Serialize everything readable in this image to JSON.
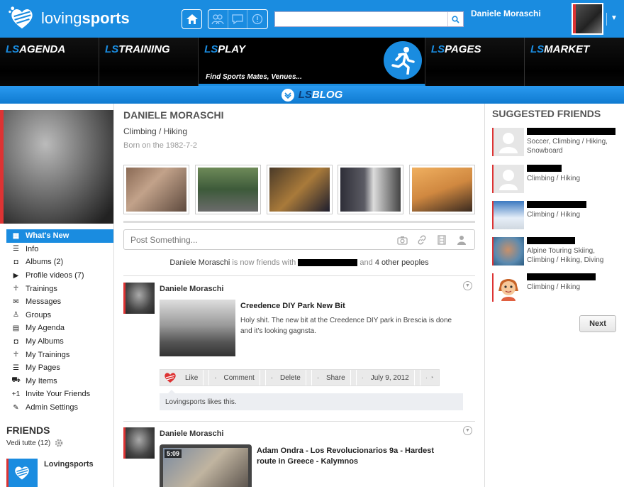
{
  "brand": {
    "name_light": "loving",
    "name_bold": "sports",
    "accent": "#1a8ce0",
    "alert": "#d33333"
  },
  "header": {
    "search_placeholder": "",
    "user_name": "Daniele Moraschi",
    "icons": [
      "home-icon",
      "friends-icon",
      "messages-icon",
      "notifications-icon",
      "search-icon",
      "chevron-down-icon"
    ]
  },
  "nav": {
    "items": [
      {
        "prefix": "LS",
        "label": "AGENDA"
      },
      {
        "prefix": "LS",
        "label": "TRAINING"
      },
      {
        "prefix": "LS",
        "label": "PLAY",
        "sub": "Find Sports Mates, Venues..."
      },
      {
        "prefix": "LS",
        "label": "PAGES"
      },
      {
        "prefix": "LS",
        "label": "MARKET"
      }
    ],
    "blog": {
      "prefix": "LS",
      "label": "BLOG"
    }
  },
  "sidebar": {
    "menu": [
      {
        "label": "What's New",
        "icon": "grid-icon"
      },
      {
        "label": "Info",
        "icon": "list-icon"
      },
      {
        "label": "Albums (2)",
        "icon": "camera-icon"
      },
      {
        "label": "Profile videos (7)",
        "icon": "play-icon"
      },
      {
        "label": "Trainings",
        "icon": "runner-icon"
      },
      {
        "label": "Messages",
        "icon": "chat-icon"
      },
      {
        "label": "Groups",
        "icon": "group-icon"
      },
      {
        "label": "My Agenda",
        "icon": "calendar-icon"
      },
      {
        "label": "My Albums",
        "icon": "camera-icon"
      },
      {
        "label": "My Trainings",
        "icon": "runner-icon"
      },
      {
        "label": "My Pages",
        "icon": "list-icon"
      },
      {
        "label": "My Items",
        "icon": "cart-icon"
      },
      {
        "label": "Invite Your Friends",
        "icon": "plus-one-icon"
      },
      {
        "label": "Admin Settings",
        "icon": "pencil-icon"
      }
    ],
    "friends_title": "FRIENDS",
    "friends_link": "Vedi tutte (12)",
    "friend_name": "Lovingsports"
  },
  "profile": {
    "name": "DANIELE MORASCHI",
    "sports": "Climbing / Hiking",
    "born": "Born on the 1982-7-2"
  },
  "composer": {
    "placeholder": "Post Something..."
  },
  "activity": {
    "actor": "Daniele Moraschi",
    "verb": "is now friends with",
    "and": "and",
    "others": "4 other peoples"
  },
  "posts": [
    {
      "author": "Daniele Moraschi",
      "title": "Creedence DIY Park New Bit",
      "text": "Holy shit. The new bit at the Creedence DIY park in Brescia is done and it's looking gagnsta.",
      "actions": [
        "Like",
        "Comment",
        "Delete",
        "Share"
      ],
      "date": "July 9, 2012",
      "likes": "Lovingsports likes this."
    },
    {
      "author": "Daniele Moraschi",
      "title": "Adam Ondra - Los Revolucionarios 9a - Hardest route in Greece - Kalymnos",
      "duration": "5:09"
    }
  ],
  "suggested": {
    "title": "SUGGESTED FRIENDS",
    "items": [
      {
        "sports": "Soccer, Climbing / Hiking, Snowboard"
      },
      {
        "sports": "Climbing / Hiking"
      },
      {
        "sports": "Climbing / Hiking"
      },
      {
        "sports": "Alpine Touring Skiing, Climbing / Hiking, Diving"
      },
      {
        "sports": "Climbing / Hiking"
      }
    ],
    "next_label": "Next"
  }
}
